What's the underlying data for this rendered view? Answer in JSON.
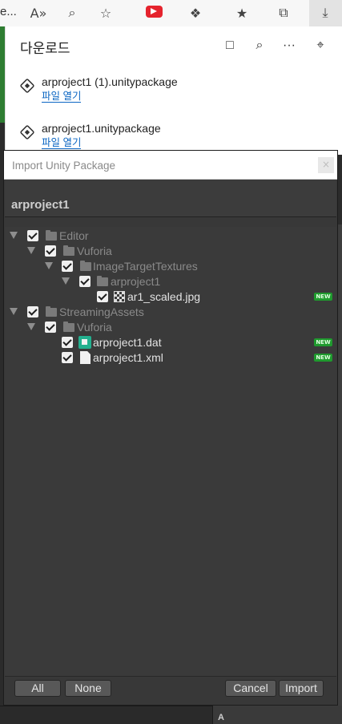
{
  "browser": {
    "tab_text": "e...",
    "icons": [
      "read-aloud-icon",
      "zoom-icon",
      "add-favorite-icon",
      "youtube-extension-icon",
      "extensions-icon",
      "favorites-icon",
      "collections-icon",
      "downloads-icon"
    ],
    "read_aloud_glyph": "A»",
    "zoom_glyph": "⌕",
    "add_favorite_glyph": "☆",
    "extensions_glyph": "❖",
    "favorites_glyph": "★",
    "collections_glyph": "⧉",
    "downloads_glyph": "⤓"
  },
  "downloads": {
    "title": "다운로드",
    "folder_glyph": "□",
    "search_glyph": "⌕",
    "more_glyph": "···",
    "pin_glyph": "⌖",
    "items": [
      {
        "name": "arproject1 (1).unitypackage",
        "action": "파일 열기"
      },
      {
        "name": "arproject1.unitypackage",
        "action": "파일 열기"
      }
    ]
  },
  "dialog": {
    "title": "Import Unity Package",
    "close_glyph": "×",
    "package_name": "arproject1",
    "tree": [
      {
        "label": "Editor",
        "level": 0,
        "kind": "folder",
        "expanded": true,
        "checked": true,
        "is_new": false
      },
      {
        "label": "Vuforia",
        "level": 1,
        "kind": "folder",
        "expanded": true,
        "checked": true,
        "is_new": false
      },
      {
        "label": "ImageTargetTextures",
        "level": 2,
        "kind": "folder",
        "expanded": true,
        "checked": true,
        "is_new": false
      },
      {
        "label": "arproject1",
        "level": 3,
        "kind": "folder",
        "expanded": true,
        "checked": true,
        "is_new": false
      },
      {
        "label": "ar1_scaled.jpg",
        "level": 4,
        "kind": "image",
        "checked": true,
        "is_new": true
      },
      {
        "label": "StreamingAssets",
        "level": 0,
        "kind": "folder",
        "expanded": true,
        "checked": true,
        "is_new": false
      },
      {
        "label": "Vuforia",
        "level": 1,
        "kind": "folder",
        "expanded": true,
        "checked": true,
        "is_new": false
      },
      {
        "label": "arproject1.dat",
        "level": 2,
        "kind": "dat",
        "checked": true,
        "is_new": true
      },
      {
        "label": "arproject1.xml",
        "level": 2,
        "kind": "file",
        "checked": true,
        "is_new": true
      }
    ],
    "new_badge": "NEW",
    "buttons": {
      "all": "All",
      "none": "None",
      "cancel": "Cancel",
      "import": "Import"
    }
  },
  "background": {
    "bottom_panel_text": "A"
  }
}
